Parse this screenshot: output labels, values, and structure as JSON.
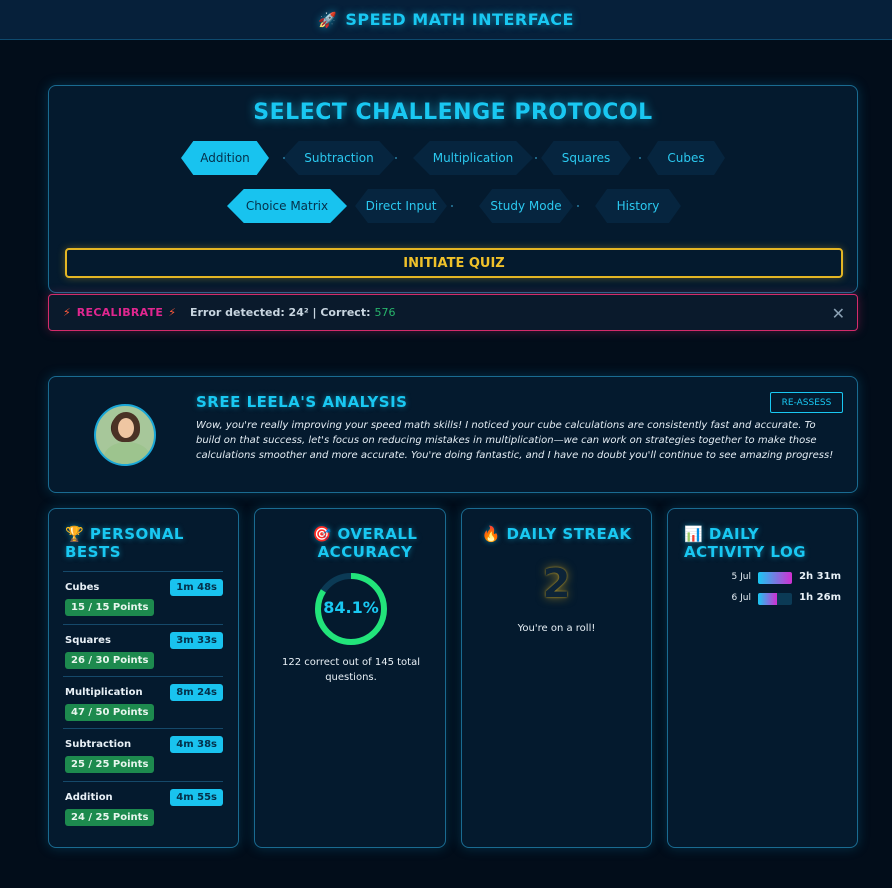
{
  "header": {
    "title": "SPEED MATH INTERFACE",
    "icon": "rocket-icon"
  },
  "challenge": {
    "title": "SELECT CHALLENGE PROTOCOL",
    "operations": [
      "Addition",
      "Subtraction",
      "Multiplication",
      "Squares",
      "Cubes"
    ],
    "selected_operation": "Addition",
    "modes": [
      "Choice Matrix",
      "Direct Input",
      "Study Mode",
      "History"
    ],
    "selected_mode": "Choice Matrix",
    "initiate_label": "INITIATE QUIZ"
  },
  "alert": {
    "label": "RECALIBRATE",
    "message": "Error detected: 24² | Correct:",
    "correct_value": "576",
    "icon": "lightning-icon"
  },
  "analysis": {
    "title": "SREE LEELA'S ANALYSIS",
    "reassess_label": "RE-ASSESS",
    "text": "Wow, you're really improving your speed math skills! I noticed your cube calculations are consistently fast and accurate. To build on that success, let's focus on reducing mistakes in multiplication—we can work on strategies together to make those calculations smoother and more accurate. You're doing fantastic, and I have no doubt you'll continue to see amazing progress!"
  },
  "bests": {
    "title": "PERSONAL BESTS",
    "icon": "trophy-icon",
    "items": [
      {
        "name": "Cubes",
        "time": "1m 48s",
        "points": "15 / 15 Points"
      },
      {
        "name": "Squares",
        "time": "3m 33s",
        "points": "26 / 30 Points"
      },
      {
        "name": "Multiplication",
        "time": "8m 24s",
        "points": "47 / 50 Points"
      },
      {
        "name": "Subtraction",
        "time": "4m 38s",
        "points": "25 / 25 Points"
      },
      {
        "name": "Addition",
        "time": "4m 55s",
        "points": "24 / 25 Points"
      }
    ]
  },
  "accuracy": {
    "title": "OVERALL ACCURACY",
    "icon": "target-icon",
    "value_label": "84.1%",
    "value": 84.1,
    "caption": "122 correct out of 145 total questions."
  },
  "streak": {
    "title": "DAILY STREAK",
    "icon": "fire-icon",
    "value": "2",
    "caption": "You're on a roll!"
  },
  "activity": {
    "title": "DAILY ACTIVITY LOG",
    "icon": "chart-icon",
    "rows": [
      {
        "date": "5 Jul",
        "time": "2h 31m",
        "fill": 1.0
      },
      {
        "date": "6 Jul",
        "time": "1h 26m",
        "fill": 0.57
      }
    ]
  },
  "colors": {
    "accent": "#19c8f2",
    "gold": "#e4b624",
    "alert": "#d42b6b",
    "success": "#1d8a4e",
    "background": "#020d1a"
  }
}
